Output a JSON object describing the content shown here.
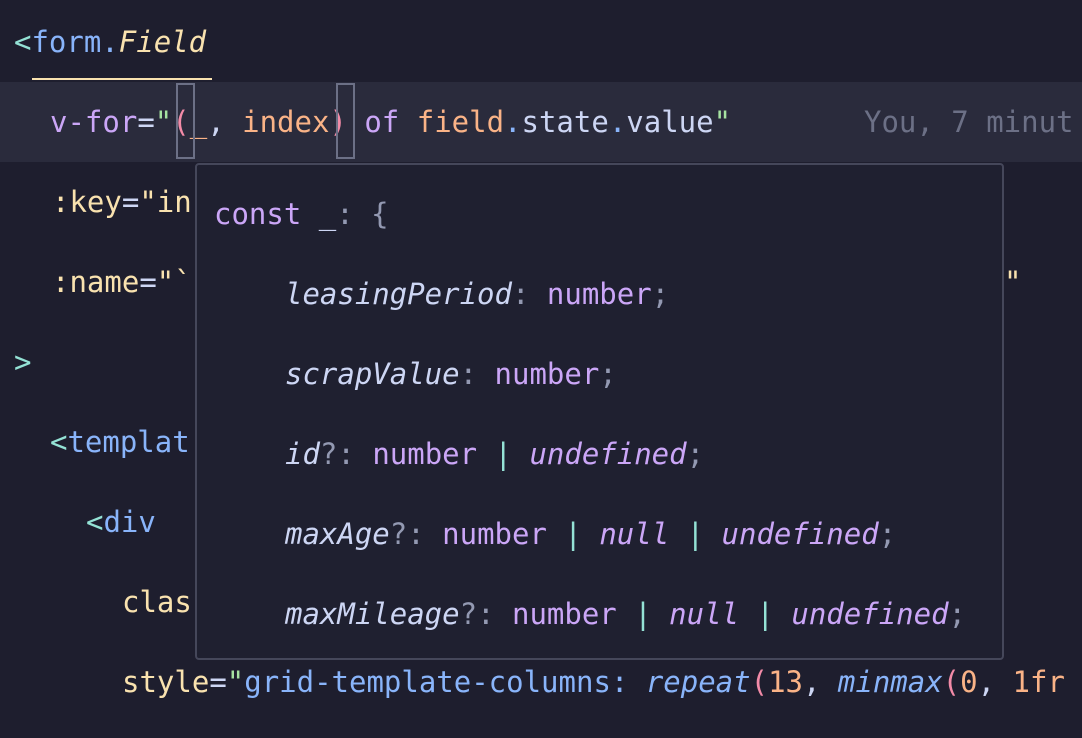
{
  "editor": {
    "lines": [
      {
        "tag_open": "<",
        "tag": "form.",
        "component": "Field"
      },
      {
        "attr": "v-for",
        "eq": "=",
        "q1": "\"",
        "p1": "(",
        "v1": "_",
        "comma": ", ",
        "v2": "index",
        "p2": ")",
        "of": " of ",
        "v3": "field",
        "dot1": ".",
        "pr1": "state",
        "dot2": ".",
        "pr2": "value",
        "q2": "\"",
        "blame": "You, 7 minut"
      },
      {
        "prefix": ":",
        "attr": "key",
        "eq": "=",
        "str": "\"in"
      },
      {
        "prefix": ":",
        "attr": "name",
        "eq": "=",
        "str": "\"`",
        "tail": "\""
      },
      {
        "bracket": ">"
      },
      {
        "lt": "<",
        "tag": "templat"
      },
      {
        "lt": "<",
        "tag": "div"
      },
      {
        "attr": "clas"
      },
      {
        "attr": "style",
        "eq": "=",
        "q": "\"",
        "css": "grid-template-columns: ",
        "fn1": "repeat",
        "p1": "(",
        "n1": "13",
        "comma": ", ",
        "fn2": "minmax",
        "p2": "(",
        "n2": "0",
        "comma2": ", ",
        "n3": "1fr"
      }
    ]
  },
  "hover": {
    "header": {
      "kw": "const",
      "id": " _",
      "colon": ": ",
      "brace": "{"
    },
    "props": [
      {
        "name": "leasingPeriod",
        "colon": ": ",
        "type": "number",
        "semi": ";"
      },
      {
        "name": "scrapValue",
        "colon": ": ",
        "type": "number",
        "semi": ";"
      },
      {
        "name": "id",
        "q": "?",
        "colon": ": ",
        "type": "number",
        "bar": " | ",
        "t2": "undefined",
        "semi": ";"
      },
      {
        "name": "maxAge",
        "q": "?",
        "colon": ": ",
        "type": "number",
        "bar": " | ",
        "t2": "null",
        "bar2": " | ",
        "t3": "undefined",
        "semi": ";"
      },
      {
        "name": "maxMileage",
        "q": "?",
        "colon": ": ",
        "type": "number",
        "bar": " | ",
        "t2": "null",
        "bar2": " | ",
        "t3": "undefined",
        "semi": ";"
      }
    ]
  },
  "colors": {
    "background": "#1e1e2e",
    "active_line": "#2a2b3c",
    "popup_background": "#1f2030",
    "popup_border": "#45475a"
  }
}
